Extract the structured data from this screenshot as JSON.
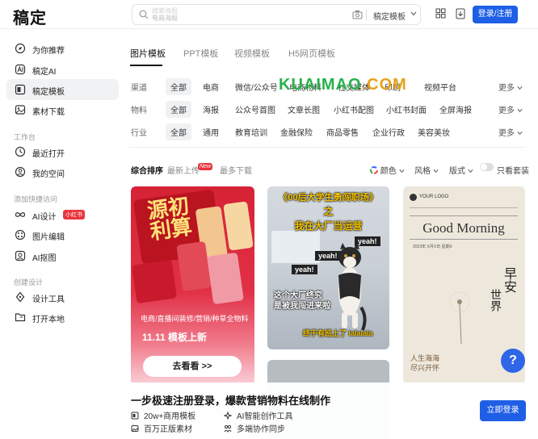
{
  "app": {
    "logo": "稿定"
  },
  "search": {
    "placeholder_line1": "搜索海报",
    "placeholder_line2": "电商海报",
    "scope": "稿定模板"
  },
  "topbar": {
    "login_label": "登录/注册"
  },
  "sidebar": {
    "items": [
      {
        "label": "为你推荐",
        "icon": "compass-icon"
      },
      {
        "label": "稿定AI",
        "icon": "ai-icon"
      },
      {
        "label": "稿定模板",
        "icon": "template-icon",
        "active": true
      },
      {
        "label": "素材下载",
        "icon": "image-icon"
      }
    ],
    "section_workspace": "工作台",
    "workspace_items": [
      {
        "label": "最近打开",
        "icon": "clock-icon"
      },
      {
        "label": "我的空间",
        "icon": "user-icon"
      }
    ],
    "section_shortcuts": "添加快捷访问",
    "shortcut_items": [
      {
        "label": "AI设计",
        "icon": "infinity-icon",
        "badge": "小红书"
      },
      {
        "label": "图片编辑",
        "icon": "palette-icon"
      },
      {
        "label": "AI抠图",
        "icon": "cutout-icon"
      }
    ],
    "section_create": "创建设计",
    "create_items": [
      {
        "label": "设计工具",
        "icon": "pen-icon"
      },
      {
        "label": "打开本地",
        "icon": "folder-icon"
      }
    ]
  },
  "tabs": [
    "图片模板",
    "PPT模板",
    "视频模板",
    "H5网页模板"
  ],
  "filters": {
    "channel": {
      "label": "渠道",
      "chips": [
        "全部",
        "电商",
        "微信/公众号",
        "电商物料",
        "社交媒体",
        "印刷",
        "视频平台"
      ]
    },
    "material": {
      "label": "物料",
      "chips": [
        "全部",
        "海报",
        "公众号首图",
        "文章长图",
        "小红书配图",
        "小红书封面",
        "全屏海报"
      ]
    },
    "industry": {
      "label": "行业",
      "chips": [
        "全部",
        "通用",
        "教育培训",
        "金融保险",
        "商品零售",
        "企业行政",
        "美容美妆"
      ]
    },
    "more": "更多"
  },
  "sort": {
    "items": [
      "综合排序",
      "最新上传",
      "最多下载"
    ],
    "new_badge": "New"
  },
  "attrs": {
    "color": "颜色",
    "style": "风格",
    "layout": "版式",
    "free_only": "只看套装"
  },
  "cards": {
    "card1": {
      "headline_a": "源初",
      "headline_b": "利算",
      "sub": "电商/直播间装修/营销/种草全物料",
      "promo": "11.11 模板上新",
      "cta": "去看看 >>"
    },
    "card2": {
      "title": "《00后大学生勇闯职场》",
      "zhi": "之",
      "line2": "我在大厂当运营",
      "yeah": "yeah!",
      "cap1": "这个大厂终究",
      "cap1b": "是被我闯进来啦",
      "cap2": "终于有班上了 lalalala"
    },
    "card3": {
      "logo": "YOUR LOGO",
      "heading": "Good Morning",
      "date": "2023年 X月X日 星期X",
      "zao": "早安",
      "shijie": "世界",
      "poem1": "人生海海",
      "poem2": "尽兴开怀"
    }
  },
  "banner": {
    "title": "一步极速注册登录，爆款营销物料在线制作",
    "features": [
      "20w+商用模板",
      "AI智能创作工具",
      "百万正版素材",
      "多端协作同步"
    ],
    "cta": "立即登录"
  },
  "help": "?",
  "watermark": {
    "text1": "K",
    "text2": "UAIMAO",
    "text3": ".COM"
  },
  "colors": {
    "brand": "#1f5fe6",
    "badge": "#e8353d"
  }
}
